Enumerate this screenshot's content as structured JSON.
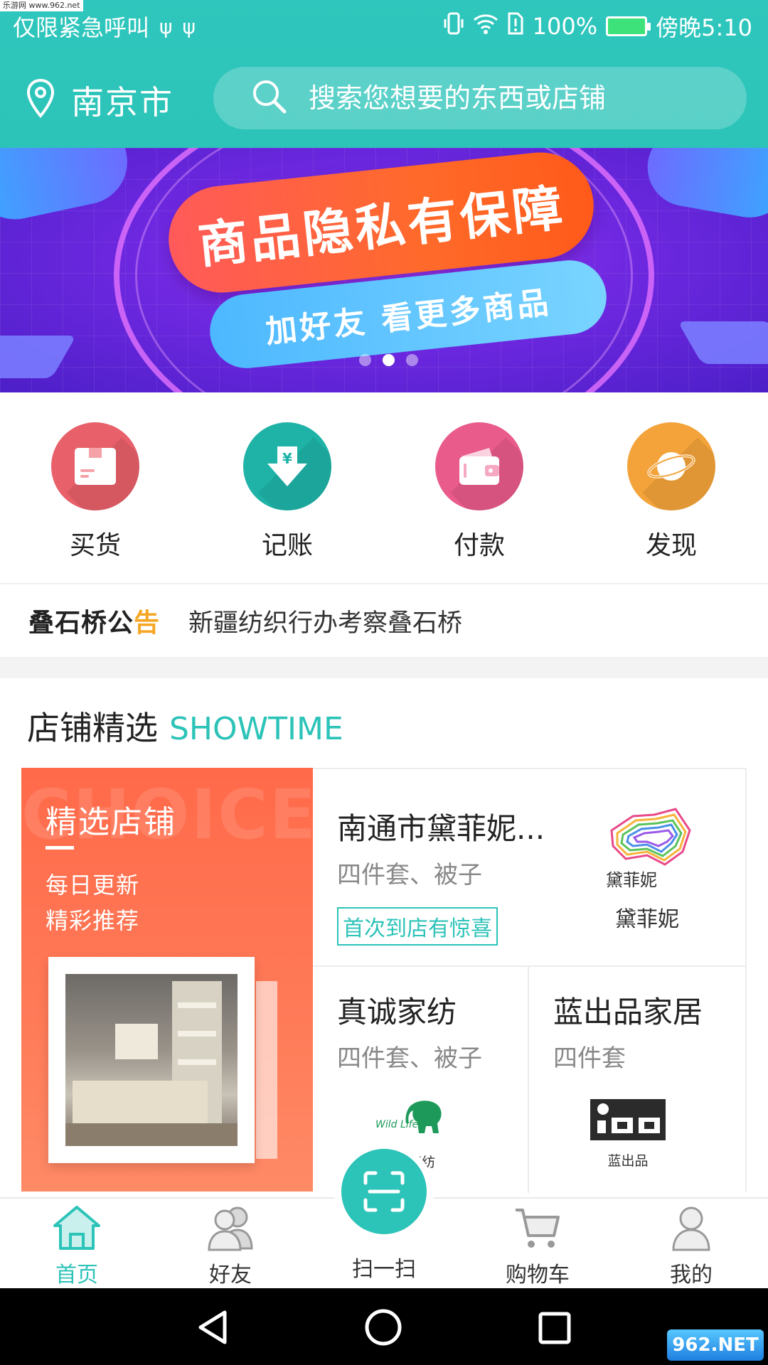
{
  "watermark_tl": "乐游网 www.962.net",
  "status_bar": {
    "carrier": "仅限紧急呼叫",
    "battery_pct": "100%",
    "time": "傍晚5:10"
  },
  "header": {
    "city": "南京市",
    "search_placeholder": "搜索您想要的东西或店铺"
  },
  "banner": {
    "title": "商品隐私有保障",
    "subtitle": "加好友 看更多商品",
    "active_slide": 2,
    "slide_count": 3
  },
  "actions": [
    {
      "label": "买货",
      "icon": "package-icon",
      "color": "#e8606a"
    },
    {
      "label": "记账",
      "icon": "yen-download-icon",
      "color": "#1fb3a8"
    },
    {
      "label": "付款",
      "icon": "wallet-icon",
      "color": "#e95b8a"
    },
    {
      "label": "发现",
      "icon": "planet-icon",
      "color": "#f3a33a"
    }
  ],
  "notice": {
    "brand_main": "叠石桥公",
    "brand_tail": "告",
    "text": "新疆纺织行办考察叠石桥"
  },
  "showtime": {
    "title_zh": "店铺精选",
    "title_en": "SHOWTIME"
  },
  "choice_card": {
    "bg_word": "CHOICE",
    "title": "精选店铺",
    "line1": "每日更新",
    "line2": "精彩推荐"
  },
  "shops": {
    "top": {
      "name": "南通市黛菲妮...",
      "category": "四件套、被子",
      "promo": "首次到店有惊喜",
      "logo_text": "黛菲妮",
      "caption": "黛菲妮"
    },
    "bottom_left": {
      "name": "真诚家纺",
      "category": "四件套、被子",
      "logo_text": "Wild Life",
      "caption": "家纺"
    },
    "bottom_right": {
      "name": "蓝出品家居",
      "category": "四件套",
      "caption": "蓝出品"
    }
  },
  "bottom_nav": {
    "home": "首页",
    "friends": "好友",
    "scan": "扫一扫",
    "cart": "购物车",
    "mine": "我的"
  },
  "watermark_br": "962.NET"
}
